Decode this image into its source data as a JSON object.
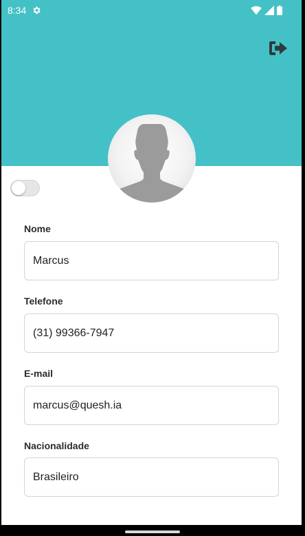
{
  "status_bar": {
    "time": "8:34",
    "icons": [
      "gear-icon",
      "wifi-icon",
      "signal-icon",
      "battery-icon"
    ]
  },
  "header": {
    "background_color": "#44c1c6",
    "logout_icon": "logout-icon"
  },
  "profile": {
    "avatar_icon": "person-silhouette-icon",
    "toggle_on": false
  },
  "form": {
    "fields": [
      {
        "label": "Nome",
        "value": "Marcus"
      },
      {
        "label": "Telefone",
        "value": "(31) 99366-7947"
      },
      {
        "label": "E-mail",
        "value": "marcus@quesh.ia"
      },
      {
        "label": "Nacionalidade",
        "value": "Brasileiro"
      }
    ]
  }
}
